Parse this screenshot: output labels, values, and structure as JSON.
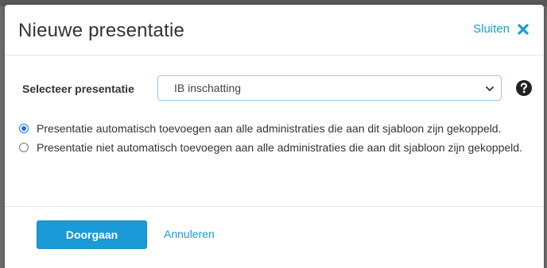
{
  "dialog": {
    "title": "Nieuwe presentatie",
    "close_label": "Sluiten",
    "close_icon": "close-x-icon"
  },
  "select": {
    "label": "Selecteer presentatie",
    "value": "IB inschatting",
    "chevron_icon": "chevron-down-icon",
    "help_icon": "question-circle-icon"
  },
  "options": [
    {
      "label": "Presentatie automatisch toevoegen aan alle administraties die aan dit sjabloon zijn gekoppeld.",
      "checked": true
    },
    {
      "label": "Presentatie niet automatisch toevoegen aan alle administraties die aan dit sjabloon zijn gekoppeld.",
      "checked": false
    }
  ],
  "footer": {
    "primary_label": "Doorgaan",
    "cancel_label": "Annuleren"
  },
  "colors": {
    "accent": "#1a9ad6",
    "radio_checked": "#1a73e8",
    "backdrop": "#6d6d6d"
  }
}
